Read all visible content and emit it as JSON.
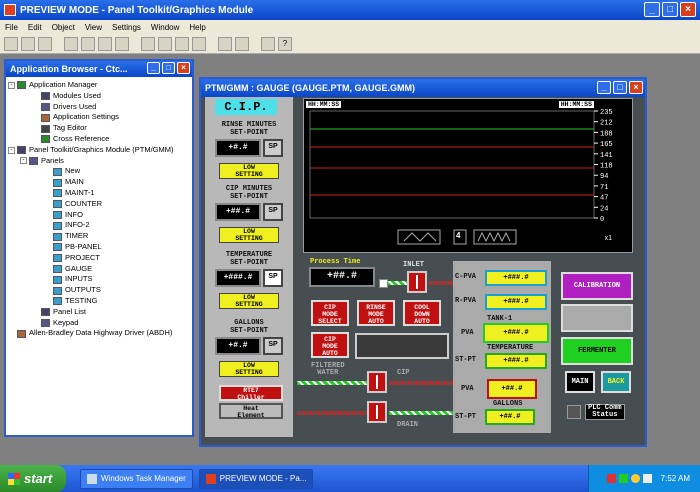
{
  "window": {
    "title": "PREVIEW MODE - Panel Toolkit/Graphics Module"
  },
  "menu": [
    "File",
    "Edit",
    "Object",
    "View",
    "Settings",
    "Window",
    "Help"
  ],
  "browser": {
    "title": "Application Browser - Ctc...",
    "items": [
      {
        "label": "Application Manager",
        "level": 0,
        "exp": "-"
      },
      {
        "label": "Modules Used",
        "level": 2
      },
      {
        "label": "Drivers Used",
        "level": 2
      },
      {
        "label": "Application Settings",
        "level": 2
      },
      {
        "label": "Tag Editor",
        "level": 2
      },
      {
        "label": "Cross Reference",
        "level": 2
      },
      {
        "label": "Panel Toolkit/Graphics Module (PTM/GMM)",
        "level": 0,
        "exp": "-"
      },
      {
        "label": "Panels",
        "level": 1,
        "exp": "-"
      },
      {
        "label": "New",
        "level": 3
      },
      {
        "label": "MAIN",
        "level": 3
      },
      {
        "label": "MAINT-1",
        "level": 3
      },
      {
        "label": "COUNTER",
        "level": 3
      },
      {
        "label": "INFO",
        "level": 3
      },
      {
        "label": "INFO-2",
        "level": 3
      },
      {
        "label": "TIMER",
        "level": 3
      },
      {
        "label": "PB-PANEL",
        "level": 3
      },
      {
        "label": "PROJECT",
        "level": 3
      },
      {
        "label": "GAUGE",
        "level": 3
      },
      {
        "label": "INPUTS",
        "level": 3
      },
      {
        "label": "OUTPUTS",
        "level": 3
      },
      {
        "label": "TESTING",
        "level": 3
      },
      {
        "label": "Panel List",
        "level": 2
      },
      {
        "label": "Keypad",
        "level": 2
      },
      {
        "label": "Allen-Bradley Data Highway Driver (ABDH)",
        "level": 0
      }
    ]
  },
  "gauge": {
    "title": "PTM/GMM : GAUGE (GAUGE.PTM, GAUGE.GMM)",
    "cip": "C.I.P.",
    "rinse_lbl": "RINSE MINUTES\nSET-POINT",
    "rinse_val": "+#.#",
    "sp": "SP",
    "low": "LOW\nSETTING",
    "cipmin_lbl": "CIP MINUTES\nSET-POINT",
    "cipmin_val": "+##.#",
    "temp_lbl": "TEMPERATURE\nSET-POINT",
    "temp_val": "+###.#",
    "gallons_lbl": "GALLONS\nSET-POINT",
    "gallons_val": "+#.#",
    "rte7": "RTE7\nChiller",
    "heat": "Heat\nElement",
    "time_left": "HH:MM:SS",
    "time_right": "HH:MM:SS",
    "yticks": [
      "235",
      "212",
      "188",
      "165",
      "141",
      "118",
      "94",
      "71",
      "47",
      "24",
      "0"
    ],
    "zoom_num": "4",
    "zoom_x": "x1",
    "process_time": "Process Time",
    "pt_val": "+##.#",
    "inlet": "INLET",
    "btn_cip_select": "CIP\nMODE\nSELECT",
    "btn_rinse": "RINSE\nMODE\nAUTO",
    "btn_cool": "COOL\nDOWN\nAUTO",
    "btn_cip_auto": "CIP\nMODE\nAUTO",
    "filtered": "FILTERED\nWATER",
    "cip_lbl": "CIP",
    "drain": "DRAIN",
    "cpva": "C-PVA",
    "rpva": "R-PVA",
    "tank": "TANK-1",
    "pva": "PVA",
    "stpt": "ST-PT",
    "temperature": "TEMPERATURE",
    "gallons": "GALLONS",
    "v1": "+###.#",
    "v2": "+###.#",
    "v3": "+###.#",
    "v4": "+###.#",
    "v5": "+##.#",
    "v6": "+##.#",
    "calibration": "CALIBRATION",
    "fermenter": "FERMENTER",
    "main": "MAIN",
    "back": "BACK",
    "plc": "PLC Comm\nStatus"
  },
  "taskbar": {
    "start": "start",
    "t1": "Windows Task Manager",
    "t2": "PREVIEW MODE - Pa...",
    "clock": "7:52 AM"
  }
}
